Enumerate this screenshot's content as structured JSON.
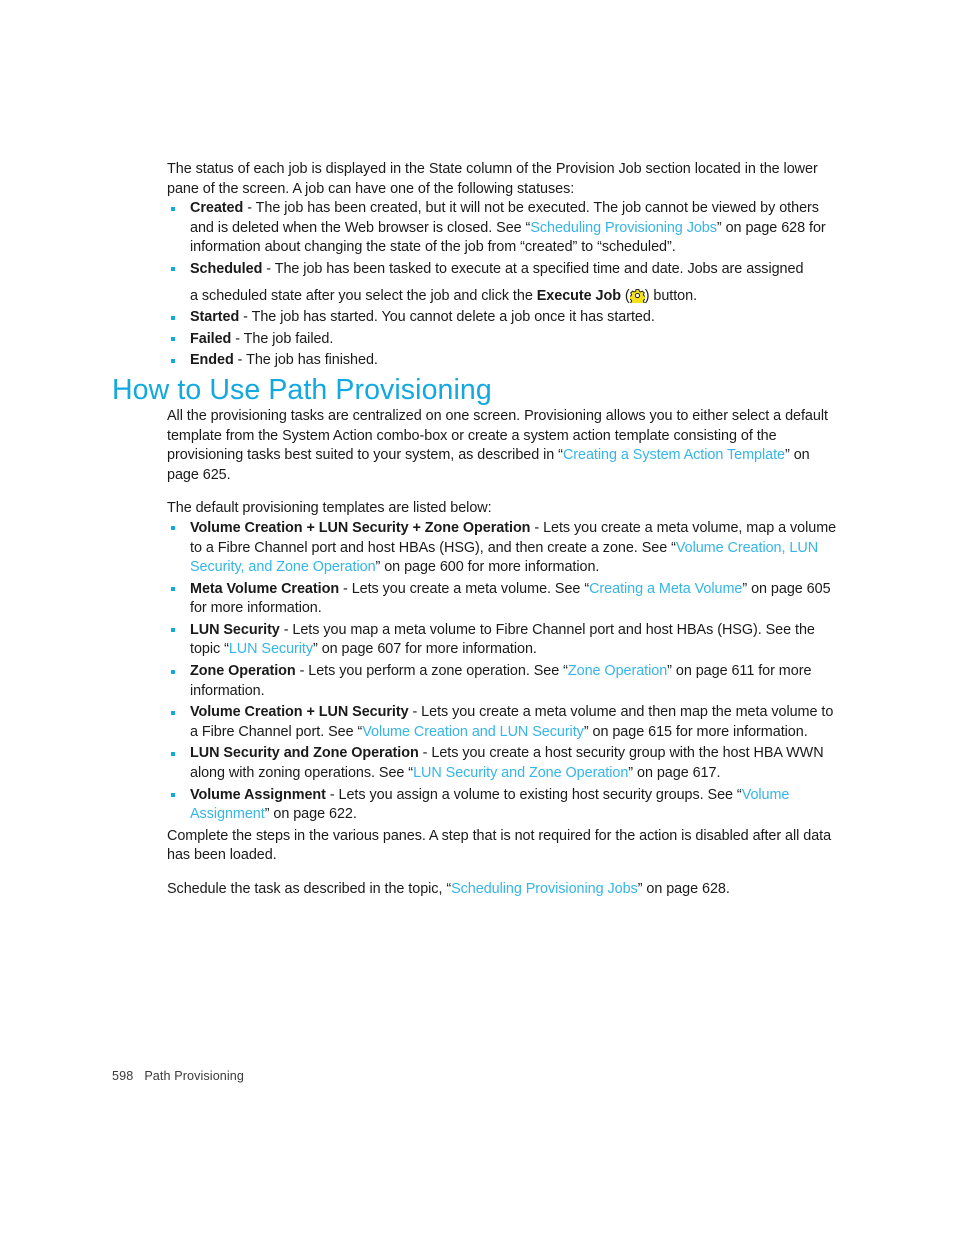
{
  "document": {
    "footer": {
      "page_number": "598",
      "chapter": "Path Provisioning"
    }
  },
  "colors": {
    "heading": "#12a8e0",
    "link": "#35b5e8",
    "bullet": "#12a8e0",
    "body_text": "#1a1a1a",
    "icon_fill": "#f5e119",
    "icon_outline": "#1a1a1a"
  },
  "intro": {
    "paragraph": "The status of each job is displayed in the State column of the Provision Job section located in the lower pane of the screen. A job can have one of the following statuses:"
  },
  "status_list": [
    {
      "term": "Created",
      "text_before": " - The job has been created, but it will not be executed. The job cannot be viewed by others and is deleted when the Web browser is closed. See “",
      "link": "Scheduling Provisioning Jobs",
      "text_after": "” on page 628 for information about changing the state of the job from “created” to “scheduled”."
    },
    {
      "term": "Scheduled",
      "text_before": " - The job has been tasked to execute at a specified time and date. Jobs are assigned",
      "second_line_before": "a scheduled state after you select the job and click the ",
      "second_line_bold": "Execute Job",
      "second_line_mid": " (",
      "icon": "execute-job-gear-icon",
      "second_line_after": ") button."
    },
    {
      "term": "Started",
      "text_before": " - The job has started. You cannot delete a job once it has started."
    },
    {
      "term": "Failed",
      "text_before": " - The job failed."
    },
    {
      "term": "Ended",
      "text_before": " - The job has finished."
    }
  ],
  "section": {
    "title": "How to Use Path Provisioning",
    "paragraph_1_before": "All the provisioning tasks are centralized on one screen. Provisioning allows you to either select a default template from the System Action combo-box or create a system action template consisting of the provisioning tasks best suited to your system, as described in “",
    "paragraph_1_link": "Creating a System Action Template",
    "paragraph_1_after": "” on page 625.",
    "paragraph_2": "The default provisioning templates are listed below:"
  },
  "template_list": [
    {
      "term": "Volume Creation + LUN Security + Zone Operation",
      "text_before": " - Lets you create a meta volume, map a volume to a Fibre Channel port and host HBAs (HSG), and then create a zone. See “",
      "link": "Volume Creation, LUN Security, and Zone Operation",
      "text_after": "” on page 600 for more information."
    },
    {
      "term": "Meta Volume Creation",
      "text_before": " - Lets you create a meta volume. See “",
      "link": "Creating a Meta Volume",
      "text_after": "” on page 605 for more information."
    },
    {
      "term": "LUN Security",
      "text_before": " - Lets you map a meta volume to Fibre Channel port and host HBAs (HSG). See the topic “",
      "link": "LUN Security",
      "text_after": "” on page 607 for more information."
    },
    {
      "term": "Zone Operation",
      "text_before": " - Lets you perform a zone operation. See “",
      "link": "Zone Operation",
      "text_after": "” on page 611 for more information."
    },
    {
      "term": "Volume Creation + LUN Security",
      "text_before": " - Lets you create a meta volume and then map the meta volume to a Fibre Channel port. See “",
      "link": "Volume Creation and LUN Security",
      "text_after": "” on page 615 for more information."
    },
    {
      "term": "LUN Security and Zone Operation",
      "text_before": " - Lets you create a host security group with the host HBA WWN along with zoning operations. See “",
      "link": "LUN Security and Zone Operation",
      "text_after": "” on page 617."
    },
    {
      "term": "Volume Assignment",
      "text_before": " - Lets you assign a volume to existing host security groups. See “",
      "link": "Volume Assignment",
      "text_after": "” on page 622."
    }
  ],
  "closing": {
    "paragraph_1": "Complete the steps in the various panes. A step that is not required for the action is disabled after all data has been loaded.",
    "paragraph_2_before": "Schedule the task as described in the topic, “",
    "paragraph_2_link": "Scheduling Provisioning Jobs",
    "paragraph_2_after": "” on page 628."
  }
}
